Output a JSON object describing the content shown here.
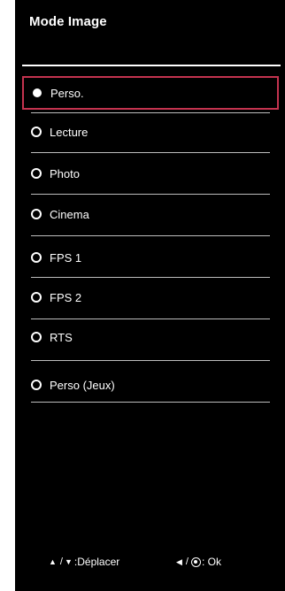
{
  "window": {
    "title": "Mode Image"
  },
  "menu": {
    "selected_index": 0,
    "items": [
      {
        "label": "Perso.",
        "selected": true
      },
      {
        "label": "Lecture",
        "selected": false
      },
      {
        "label": "Photo",
        "selected": false
      },
      {
        "label": "Cinema",
        "selected": false
      },
      {
        "label": "FPS 1",
        "selected": false
      },
      {
        "label": "FPS 2",
        "selected": false
      },
      {
        "label": "RTS",
        "selected": false
      },
      {
        "label": "Perso (Jeux)",
        "selected": false
      }
    ]
  },
  "footer": {
    "move_up_icon": "up-triangle-icon",
    "move_separator": "/",
    "move_down_icon": "down-triangle-icon",
    "move_label": ":Déplacer",
    "ok_left_icon": "left-triangle-icon",
    "ok_separator": "/",
    "ok_center_icon": "center-button-icon",
    "ok_label": ": Ok"
  },
  "colors": {
    "background": "#000000",
    "text": "#ffffff",
    "selection_border": "#c4334f",
    "divider": "#bdbdbd"
  }
}
